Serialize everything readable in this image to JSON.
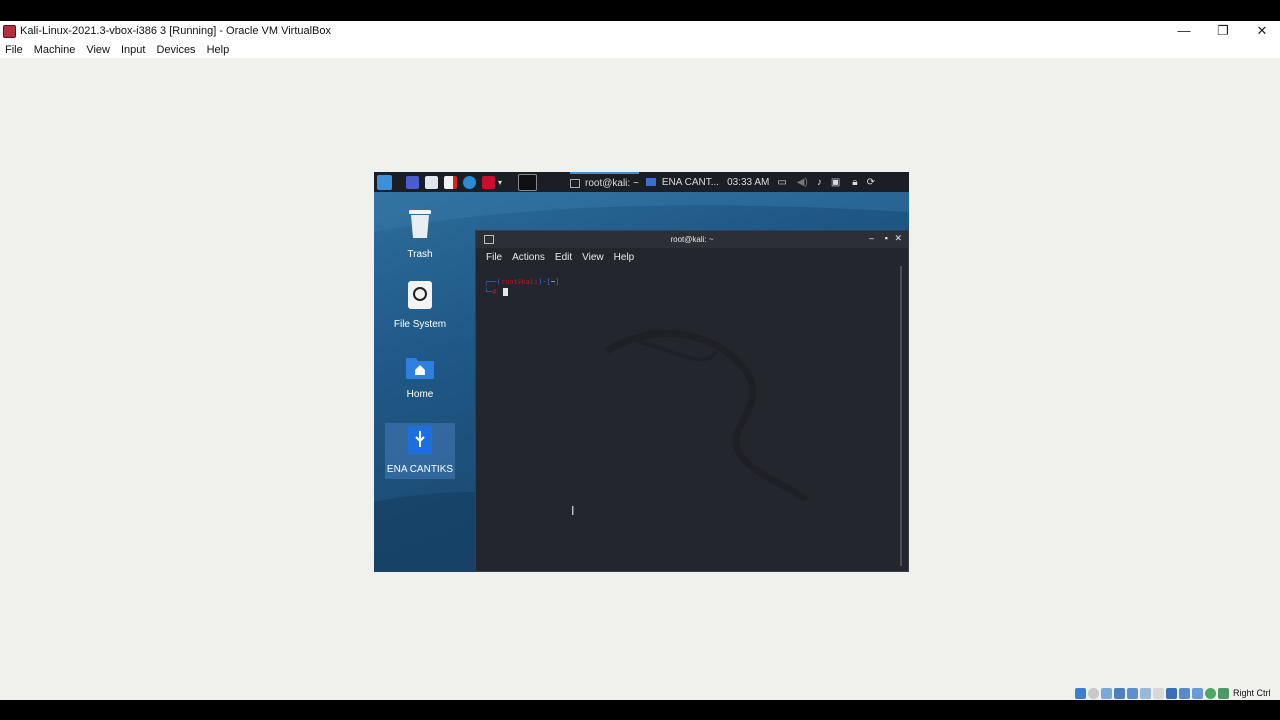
{
  "window": {
    "title": "Kali-Linux-2021.3-vbox-i386 3 [Running] - Oracle VM VirtualBox",
    "minimize_glyph": "—",
    "restore_glyph": "❐",
    "close_glyph": "✕"
  },
  "menubar": {
    "items": [
      "File",
      "Machine",
      "View",
      "Input",
      "Devices",
      "Help"
    ]
  },
  "kali_panel": {
    "terminal_task": "root@kali: ~",
    "folder_task": "ENA CANT...",
    "clock": "03:33 AM"
  },
  "desktop": {
    "icons": [
      {
        "label": "Trash",
        "icon": "trash-icon"
      },
      {
        "label": "File System",
        "icon": "drive-icon"
      },
      {
        "label": "Home",
        "icon": "home-folder-icon"
      },
      {
        "label": "ENA CANTIKS",
        "icon": "usb-drive-icon"
      }
    ]
  },
  "terminal": {
    "title": "root@kali: ~",
    "menu": [
      "File",
      "Actions",
      "Edit",
      "View",
      "Help"
    ],
    "prompt_user": "root",
    "prompt_host": "kali",
    "prompt_dir": "~"
  },
  "statusbar": {
    "host_key": "Right Ctrl"
  },
  "colors": {
    "kali_blue": "#1f5886",
    "panel_bg": "#1b1f25",
    "terminal_bg": "#23272d",
    "prompt_red": "#b5162a",
    "prompt_blue": "#3a6fd8"
  }
}
